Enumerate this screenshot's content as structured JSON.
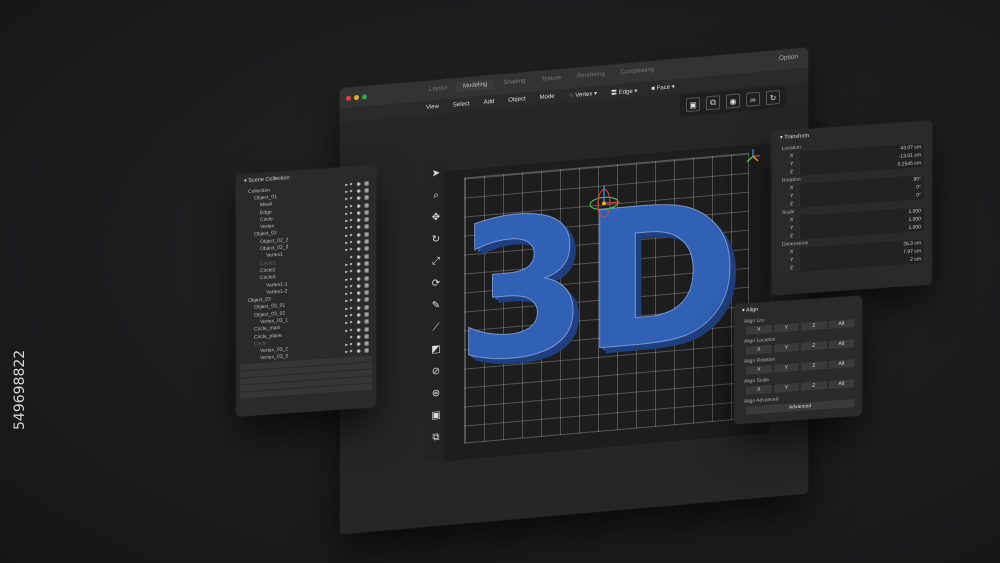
{
  "stock_id": "549698822",
  "window": {
    "tabs": [
      "Layout",
      "Modeling",
      "Shading",
      "Texture",
      "Rendering",
      "Compositing"
    ],
    "active_tab": "Modeling",
    "option_label": "Option",
    "traffic_colors": [
      "#e0443e",
      "#e6b025",
      "#2fa84f"
    ]
  },
  "menu": {
    "items": [
      "View",
      "Select",
      "Add",
      "Object",
      "Mode"
    ],
    "vertex": "Vertex",
    "edge": "Edge",
    "face": "Face"
  },
  "viewport": {
    "model_text": "3D",
    "model_color": "#3061b5"
  },
  "scene": {
    "title": "Scene Collection",
    "rows": [
      {
        "name": "Collection",
        "indent": 1,
        "icons": "▸✦ ◉ ▦"
      },
      {
        "name": "Object_01",
        "indent": 2,
        "icons": "▸✦ ◉ ▦"
      },
      {
        "name": "Mesh",
        "indent": 3,
        "icons": "▸✦ ◉ ▦"
      },
      {
        "name": "Edge",
        "indent": 3,
        "icons": "▸✦ ◉ ▦"
      },
      {
        "name": "Circle",
        "indent": 3,
        "icons": "▸✦ ◉ ▦"
      },
      {
        "name": "Vertex",
        "indent": 3,
        "icons": "▸✦ ◉ ▦"
      },
      {
        "name": "Object_02",
        "indent": 2,
        "icons": "▸✦ ◉ ▦"
      },
      {
        "name": "Object_02_2",
        "indent": 3,
        "icons": "▸✦ ◉ ▦"
      },
      {
        "name": "Object_02_3",
        "indent": 3,
        "icons": "▸✦ ◉ ▦"
      },
      {
        "name": "Vertex1",
        "indent": 4,
        "icons": "▸✦ ◉ ▦"
      },
      {
        "name": "Circle1",
        "indent": 3,
        "icons": "✦ ◉ ▦",
        "faded": true
      },
      {
        "name": "Circle2",
        "indent": 3,
        "icons": "▸✦ ◉ ▦"
      },
      {
        "name": "Circle3",
        "indent": 3,
        "icons": "▸✦ ◉ ▦"
      },
      {
        "name": "Vertex1-1",
        "indent": 4,
        "icons": "▸✦ ◉ ▦"
      },
      {
        "name": "Vertex1-2",
        "indent": 4,
        "icons": "▸✦ ◉ ▦"
      },
      {
        "name": "Object_03",
        "indent": 1,
        "icons": "▸✦ ◉ ▦"
      },
      {
        "name": "Object_03_01",
        "indent": 2,
        "icons": "▸✦ ◉ ▦"
      },
      {
        "name": "Object_03_02",
        "indent": 2,
        "icons": "▸✦ ◉ ▦"
      },
      {
        "name": "Vertex_03_1",
        "indent": 3,
        "icons": "▸✦ ◉ ▦"
      },
      {
        "name": "Circle_main",
        "indent": 2,
        "icons": "▸✦ ◉ ▦"
      },
      {
        "name": "Circle_plane",
        "indent": 2,
        "icons": "▸✦ ◉ ▦"
      },
      {
        "name": "Circle",
        "indent": 2,
        "icons": "✦ ◉ ▦",
        "faded": true
      },
      {
        "name": "Vertex_03_2",
        "indent": 3,
        "icons": "▸✦ ◉ ▦"
      },
      {
        "name": "Vertex_03_3",
        "indent": 3,
        "icons": "▸✦ ◉ ▦"
      }
    ]
  },
  "transform": {
    "title": "Transform",
    "location_label": "Location",
    "location": {
      "X": "43.07 cm",
      "Y": "-13.01 cm",
      "Z": "0.2545 cm"
    },
    "rotation_label": "Rotation",
    "rotation": {
      "X": "90°",
      "Y": "0°",
      "Z": "0°"
    },
    "scale_label": "Scale",
    "scale": {
      "X": "1.000",
      "Y": "1.000",
      "Z": "1.000"
    },
    "dimensions_label": "Dimensions",
    "dimensions": {
      "X": "26.3 cm",
      "Y": "7.97 cm",
      "Z": "2 cm"
    }
  },
  "align": {
    "title": "Align",
    "groups": [
      {
        "label": "Align Loc",
        "buttons": [
          "X",
          "Y",
          "Z",
          "All"
        ]
      },
      {
        "label": "Align Location",
        "buttons": [
          "X",
          "Y",
          "Z",
          "All"
        ]
      },
      {
        "label": "Align Rotation",
        "buttons": [
          "X",
          "Y",
          "Z",
          "All"
        ]
      },
      {
        "label": "Align Scale",
        "buttons": [
          "X",
          "Y",
          "Z",
          "All"
        ]
      }
    ],
    "advanced_label": "Align Advanced",
    "advanced_button": "Advanced"
  }
}
